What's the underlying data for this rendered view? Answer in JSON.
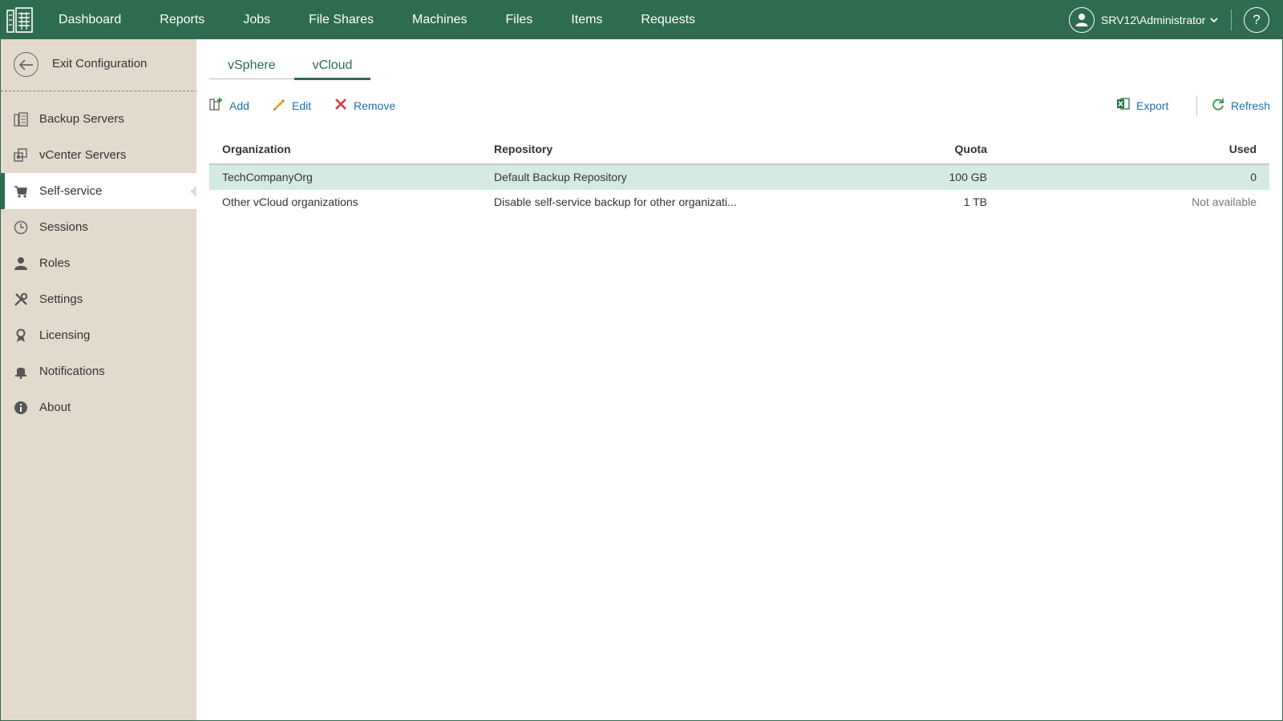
{
  "topbar": {
    "nav": [
      "Dashboard",
      "Reports",
      "Jobs",
      "File Shares",
      "Machines",
      "Files",
      "Items",
      "Requests"
    ],
    "user": "SRV12\\Administrator",
    "help": "?"
  },
  "sidebar": {
    "exit_label": "Exit Configuration",
    "items": [
      {
        "label": "Backup Servers",
        "icon": "backup-servers-icon"
      },
      {
        "label": "vCenter Servers",
        "icon": "vcenter-servers-icon"
      },
      {
        "label": "Self-service",
        "icon": "cart-icon",
        "active": true
      },
      {
        "label": "Sessions",
        "icon": "clock-icon"
      },
      {
        "label": "Roles",
        "icon": "person-icon"
      },
      {
        "label": "Settings",
        "icon": "wrench-icon"
      },
      {
        "label": "Licensing",
        "icon": "license-icon"
      },
      {
        "label": "Notifications",
        "icon": "bell-icon"
      },
      {
        "label": "About",
        "icon": "info-icon"
      }
    ]
  },
  "tabs": [
    {
      "label": "vSphere",
      "active": false
    },
    {
      "label": "vCloud",
      "active": true
    }
  ],
  "toolbar": {
    "add": "Add",
    "edit": "Edit",
    "remove": "Remove",
    "export": "Export",
    "refresh": "Refresh"
  },
  "table": {
    "headers": [
      "Organization",
      "Repository",
      "Quota",
      "Used"
    ],
    "rows": [
      {
        "organization": "TechCompanyOrg",
        "repository": "Default Backup Repository",
        "quota": "100 GB",
        "used": "0",
        "selected": true
      },
      {
        "organization": "Other vCloud organizations",
        "repository": "Disable self-service backup for other organizati...",
        "quota": "1 TB",
        "used": "Not available",
        "selected": false
      }
    ]
  },
  "colors": {
    "brand_green": "#2f6b4f",
    "sidebar_bg": "#e3dace",
    "selected_row": "#d5ebe2",
    "link_blue": "#1f6fb0"
  }
}
